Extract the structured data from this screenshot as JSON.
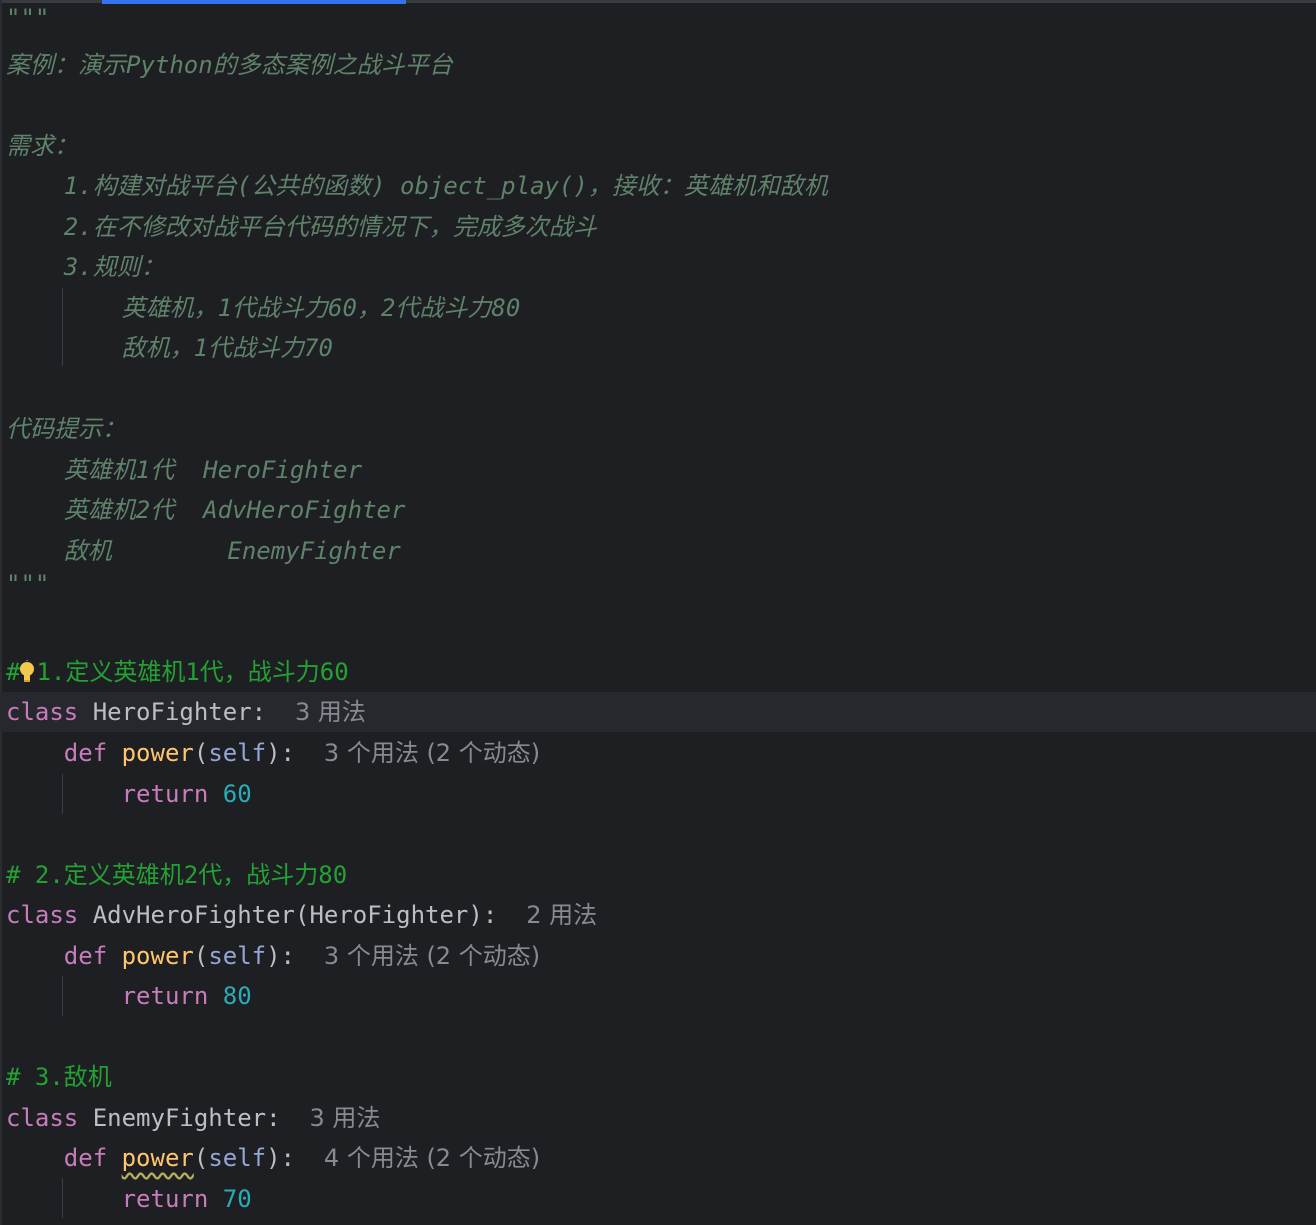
{
  "colors": {
    "background": "#1e1f22",
    "docstring": "#5f826b",
    "comment": "#23a233",
    "keyword": "#c77dbb",
    "function": "#ffc66d",
    "number": "#2aacb8",
    "hint": "#868a91",
    "tab_accent": "#3574f0"
  },
  "code": {
    "doc_open": "\"\"\"",
    "doc_title": "案例：演示Python的多态案例之战斗平台",
    "doc_req": "需求：",
    "doc_r1": "    1.构建对战平台(公共的函数) object_play()，接收：英雄机和敌机",
    "doc_r2": "    2.在不修改对战平台代码的情况下，完成多次战斗",
    "doc_r3": "    3.规则：",
    "doc_r3a": "        英雄机，1代战斗力60，2代战斗力80",
    "doc_r3b": "        敌机，1代战斗力70",
    "doc_hint": "代码提示：",
    "doc_h1": "    英雄机1代  HeroFighter",
    "doc_h2": "    英雄机2代  AdvHeroFighter",
    "doc_h3": "    敌机        EnemyFighter",
    "doc_close": "\"\"\"",
    "c1_hash": "#",
    "c1_text": "1.定义英雄机1代，战斗力60",
    "class1_kw": "class",
    "class1_name": " HeroFighter:",
    "class1_hint": "3 用法",
    "def1_kw": "def",
    "def1_name": "power",
    "def1_open": "(",
    "def1_self": "self",
    "def1_close": "):",
    "def1_hint": "3 个用法 (2 个动态)",
    "ret1_kw": "return",
    "ret1_val": "60",
    "c2": "# 2.定义英雄机2代，战斗力80",
    "class2_kw": "class",
    "class2_name": " AdvHeroFighter(HeroFighter):",
    "class2_hint": "2 用法",
    "def2_kw": "def",
    "def2_name": "power",
    "def2_open": "(",
    "def2_self": "self",
    "def2_close": "):",
    "def2_hint": "3 个用法 (2 个动态)",
    "ret2_kw": "return",
    "ret2_val": "80",
    "c3": "# 3.敌机",
    "class3_kw": "class",
    "class3_name": " EnemyFighter:",
    "class3_hint": "3 用法",
    "def3_kw": "def",
    "def3_name": "power",
    "def3_open": "(",
    "def3_self": "self",
    "def3_close": "):",
    "def3_hint": "4 个用法 (2 个动态)",
    "ret3_kw": "return",
    "ret3_val": "70"
  },
  "icons": {
    "intention": "lightbulb-icon"
  }
}
